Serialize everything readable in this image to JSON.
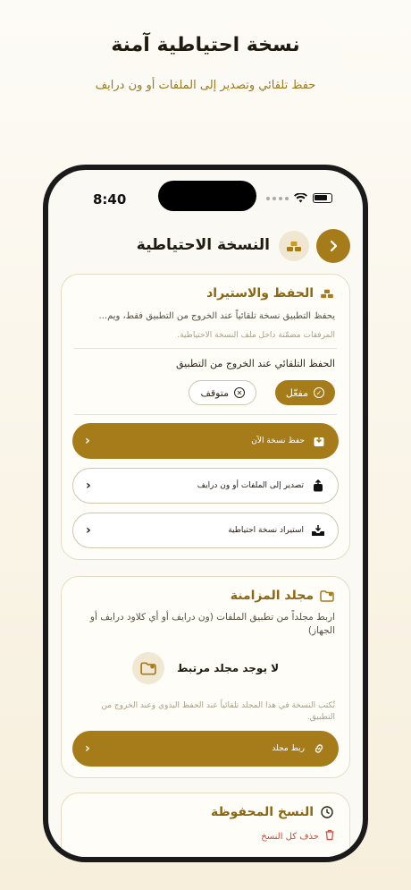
{
  "hero": {
    "title": "نسخة احتياطية آمنة",
    "subtitle": "حفظ تلقائي وتصدير إلى الملفات أو ون درايف"
  },
  "status_bar": {
    "time": "8:40"
  },
  "nav": {
    "title": "النسخة الاحتياطية",
    "back_icon": "chevron-right-icon",
    "header_icon": "gold-bars-icon"
  },
  "save_import": {
    "title": "الحفظ والاستيراد",
    "icon": "gold-bars-icon",
    "description": "يحفظ التطبيق نسخة تلقائياً عند الخروج من التطبيق فقط، ويم...",
    "note": "المرفقات مضمّنة داخل ملف النسخة الاحتياطية.",
    "autosave_label": "الحفظ التلقائي عند الخروج من التطبيق",
    "toggle_on": "مفعّل",
    "toggle_off": "متوقف",
    "actions": [
      {
        "label": "حفظ نسخة الآن",
        "icon": "download-box-icon"
      },
      {
        "label": "تصدير إلى الملفات أو ون درايف",
        "icon": "share-icon"
      },
      {
        "label": "استيراد نسخة احتياطية",
        "icon": "inbox-download-icon"
      }
    ]
  },
  "sync_folder": {
    "title": "مجلد المزامنة",
    "icon": "folder-icon",
    "description": "اربط مجلداً من تطبيق الملفات (ون درايف أو أي كلاود درايف أو الجهاز)",
    "empty_text": "لا يوجد مجلد مرتبط",
    "note": "تُكتب النسخة في هذا المجلد تلقائياً عند الحفظ اليدوي وعند الخروج من التطبيق.",
    "link_button": "ربط مجلد"
  },
  "saved_copies": {
    "title": "النسخ المحفوظة",
    "delete_all": "حذف كل النسخ"
  },
  "colors": {
    "accent": "#a67c1a",
    "danger": "#d0493b",
    "background": "#fbf9f3"
  }
}
